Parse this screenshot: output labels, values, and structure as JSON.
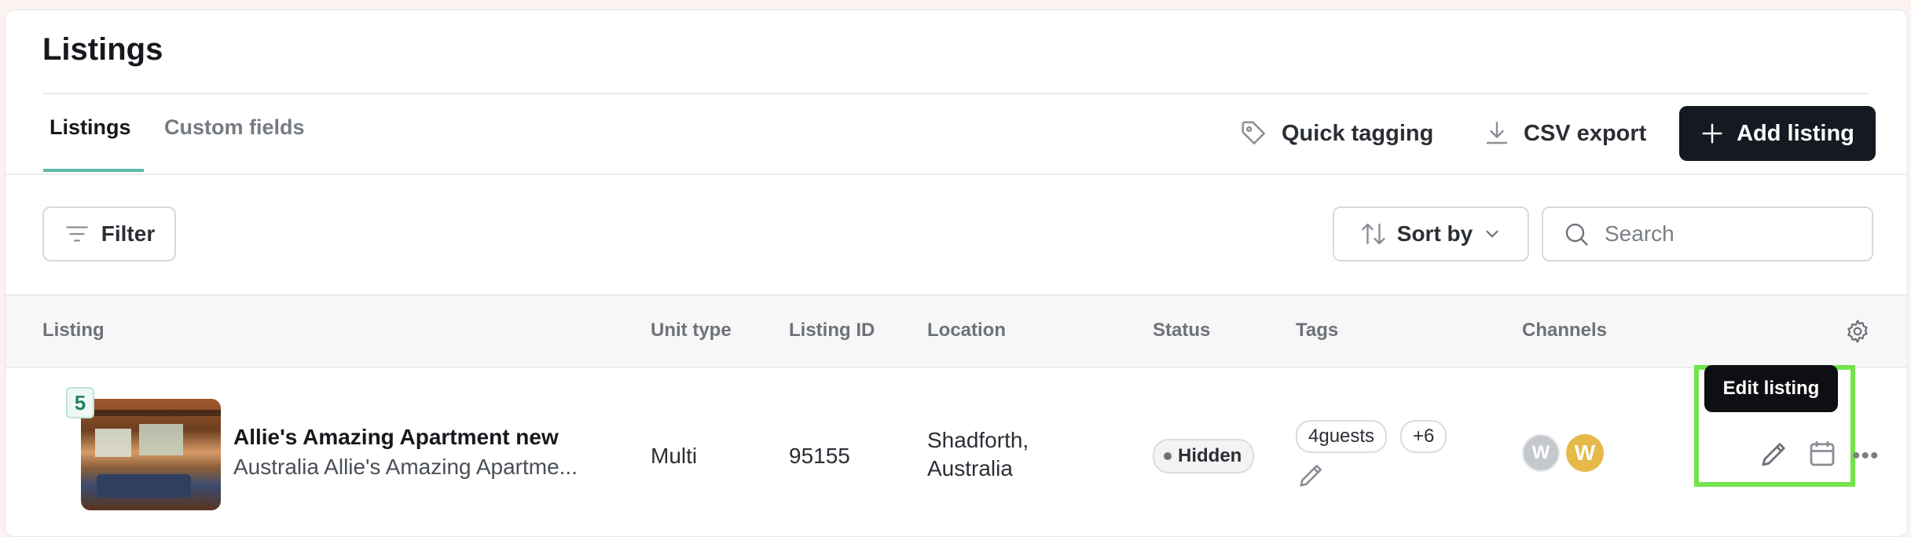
{
  "header": {
    "title": "Listings",
    "tabs": [
      {
        "label": "Listings",
        "active": true
      },
      {
        "label": "Custom fields",
        "active": false
      }
    ],
    "actions": {
      "quick_tagging": "Quick tagging",
      "csv_export": "CSV export",
      "add_listing": "Add listing"
    }
  },
  "toolbar": {
    "filter_label": "Filter",
    "sort_label": "Sort by",
    "search_placeholder": "Search"
  },
  "table": {
    "columns": [
      "Listing",
      "Unit type",
      "Listing ID",
      "Location",
      "Status",
      "Tags",
      "Channels"
    ],
    "rows": [
      {
        "photo_count": "5",
        "name": "Allie's Amazing Apartment new",
        "subtitle": "Australia Allie's Amazing Apartme...",
        "unit_type": "Multi",
        "listing_id": "95155",
        "location_line1": "Shadforth,",
        "location_line2": "Australia",
        "status": "Hidden",
        "tags": [
          "4guests",
          "+6"
        ],
        "channels": [
          {
            "icon": "channel-w-icon",
            "label": "W",
            "color": "#c4c7cc"
          },
          {
            "icon": "channel-w-icon",
            "label": "W",
            "color": "#e6b94a"
          }
        ]
      }
    ]
  },
  "tooltip": "Edit listing",
  "colors": {
    "accent": "#5fb7ac",
    "primary_button": "#151a22",
    "highlight": "#72e44a"
  }
}
